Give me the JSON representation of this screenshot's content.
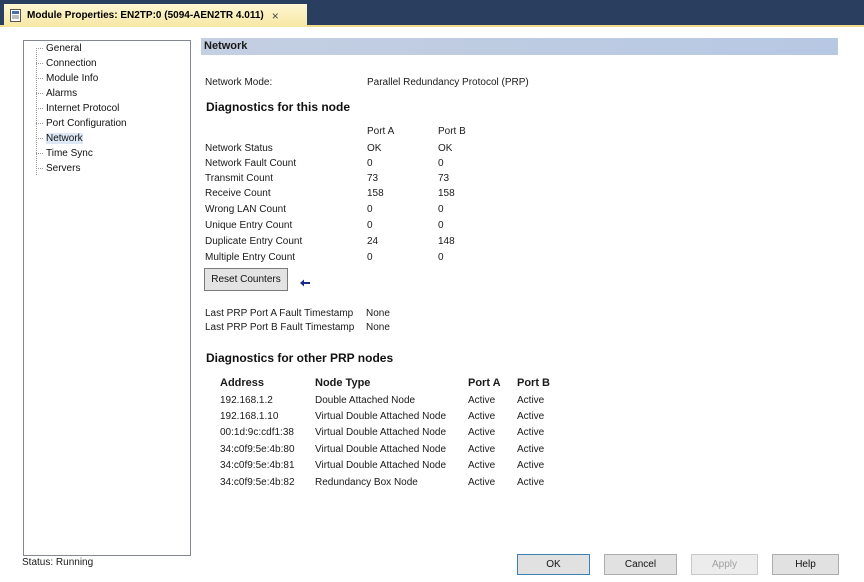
{
  "window": {
    "tab_title": "Module Properties: EN2TP:0 (5094-AEN2TR 4.011)",
    "tab_close": "×"
  },
  "tree": {
    "items": [
      {
        "label": "General"
      },
      {
        "label": "Connection"
      },
      {
        "label": "Module Info"
      },
      {
        "label": "Alarms"
      },
      {
        "label": "Internet Protocol"
      },
      {
        "label": "Port Configuration"
      },
      {
        "label": "Network",
        "selected": true
      },
      {
        "label": "Time Sync"
      },
      {
        "label": "Servers"
      }
    ]
  },
  "panel": {
    "title": "Network",
    "network_mode_label": "Network Mode:",
    "network_mode_value": "Parallel Redundancy Protocol (PRP)",
    "diag_this_title": "Diagnostics for this node",
    "port_a_header": "Port A",
    "port_b_header": "Port B",
    "stats": [
      {
        "label": "Network Status",
        "a": "OK",
        "b": "OK"
      },
      {
        "label": "Network Fault Count",
        "a": "0",
        "b": "0"
      },
      {
        "label": "Transmit Count",
        "a": "73",
        "b": "73"
      },
      {
        "label": "Receive Count",
        "a": "158",
        "b": "158"
      },
      {
        "label": "Wrong LAN Count",
        "a": "0",
        "b": "0"
      },
      {
        "label": "Unique Entry Count",
        "a": "0",
        "b": "0"
      },
      {
        "label": "Duplicate Entry Count",
        "a": "24",
        "b": "148"
      },
      {
        "label": "Multiple Entry Count",
        "a": "0",
        "b": "0"
      }
    ],
    "reset_button": "Reset Counters",
    "fault_a_label": "Last PRP Port A Fault Timestamp",
    "fault_a_value": "None",
    "fault_b_label": "Last PRP Port B Fault Timestamp",
    "fault_b_value": "None",
    "diag_other_title": "Diagnostics for other PRP nodes",
    "nodes_headers": {
      "address": "Address",
      "node_type": "Node Type",
      "port_a": "Port A",
      "port_b": "Port B"
    },
    "nodes": [
      {
        "address": "192.168.1.2",
        "node_type": "Double Attached Node",
        "port_a": "Active",
        "port_b": "Active"
      },
      {
        "address": "192.168.1.10",
        "node_type": "Virtual Double Attached Node",
        "port_a": "Active",
        "port_b": "Active"
      },
      {
        "address": "00:1d:9c:cdf1:38",
        "node_type": "Virtual Double Attached Node",
        "port_a": "Active",
        "port_b": "Active"
      },
      {
        "address": "34:c0f9:5e:4b:80",
        "node_type": "Virtual Double Attached Node",
        "port_a": "Active",
        "port_b": "Active"
      },
      {
        "address": "34:c0f9:5e:4b:81",
        "node_type": "Virtual Double Attached Node",
        "port_a": "Active",
        "port_b": "Active"
      },
      {
        "address": "34:c0f9:5e:4b:82",
        "node_type": "Redundancy Box Node",
        "port_a": "Active",
        "port_b": "Active"
      }
    ]
  },
  "footer": {
    "status": "Status:  Running",
    "ok": "OK",
    "cancel": "Cancel",
    "apply": "Apply",
    "help": "Help"
  },
  "colors": {
    "tab_bar": "#2a3f5f",
    "tab_active": "#f7e7a4",
    "section_header": "#b7c8e3",
    "arrow": "#1b2a8a"
  },
  "icons": {
    "doc": "document-icon",
    "arrow": "arrow-left-icon"
  }
}
